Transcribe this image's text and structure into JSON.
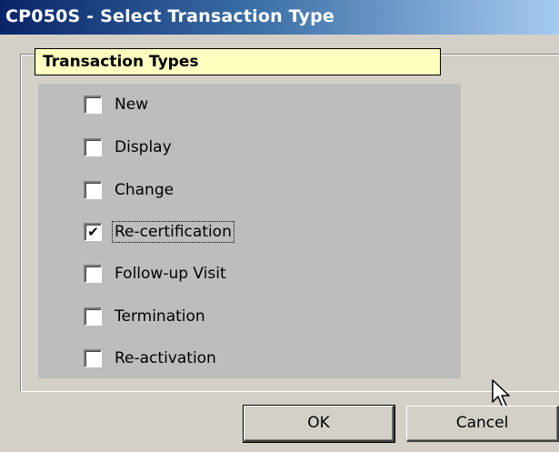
{
  "window": {
    "title": "CP050S - Select Transaction Type"
  },
  "group": {
    "header": "Transaction Types"
  },
  "options": [
    {
      "label": "New",
      "checked": false
    },
    {
      "label": "Display",
      "checked": false
    },
    {
      "label": "Change",
      "checked": false
    },
    {
      "label": "Re-certification",
      "checked": true,
      "focused": true
    },
    {
      "label": "Follow-up Visit",
      "checked": false
    },
    {
      "label": "Termination",
      "checked": false
    },
    {
      "label": "Re-activation",
      "checked": false
    }
  ],
  "buttons": {
    "ok_label": "OK",
    "cancel_label": "Cancel"
  },
  "icons": {
    "check": "checkmark-icon",
    "cursor": "mouse-pointer-icon"
  },
  "colors": {
    "title_bar": "#0a246a",
    "header_bg": "#ffffc0",
    "panel_bg": "#bdbdbd",
    "window_bg": "#d4d0c8"
  }
}
